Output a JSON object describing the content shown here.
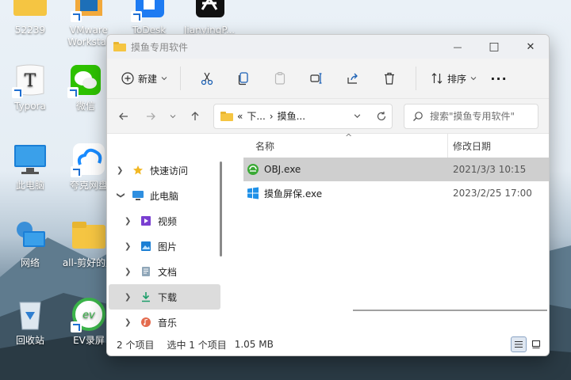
{
  "desktop": {
    "icons": [
      {
        "label": "52239"
      },
      {
        "label": "VMware Workstat"
      },
      {
        "label": "ToDesk"
      },
      {
        "label": "JianyingP..."
      },
      {
        "label": "Typora"
      },
      {
        "label": "微信"
      },
      {
        "label": "此电脑"
      },
      {
        "label": "夸克网盘"
      },
      {
        "label": "网络"
      },
      {
        "label": "all-剪好的屏"
      },
      {
        "label": "回收站"
      },
      {
        "label": "EV录屏"
      }
    ]
  },
  "window": {
    "title": "摸鱼专用软件",
    "controls": {
      "minimize": "—",
      "maximize": "□",
      "close": "✕"
    }
  },
  "toolbar": {
    "new_label": "新建",
    "sort_label": "排序",
    "more_label": "···"
  },
  "address": {
    "prefix": "«",
    "segment1": "下...",
    "separator": "›",
    "segment2": "摸鱼..."
  },
  "search": {
    "placeholder": "搜索\"摸鱼专用软件\""
  },
  "navpane": {
    "items": [
      {
        "label": "快速访问"
      },
      {
        "label": "此电脑"
      },
      {
        "label": "视频"
      },
      {
        "label": "图片"
      },
      {
        "label": "文档"
      },
      {
        "label": "下载"
      },
      {
        "label": "音乐"
      }
    ]
  },
  "filelist": {
    "columns": {
      "name": "名称",
      "date": "修改日期"
    },
    "rows": [
      {
        "name": "OBJ.exe",
        "date": "2021/3/3 10:15"
      },
      {
        "name": "摸鱼屏保.exe",
        "date": "2023/2/25 17:00"
      }
    ]
  },
  "status": {
    "count": "2 个项目",
    "selected": "选中 1 个项目",
    "size": "1.05 MB"
  },
  "colors": {
    "accent": "#0067c0",
    "folder": "#f5c542"
  }
}
